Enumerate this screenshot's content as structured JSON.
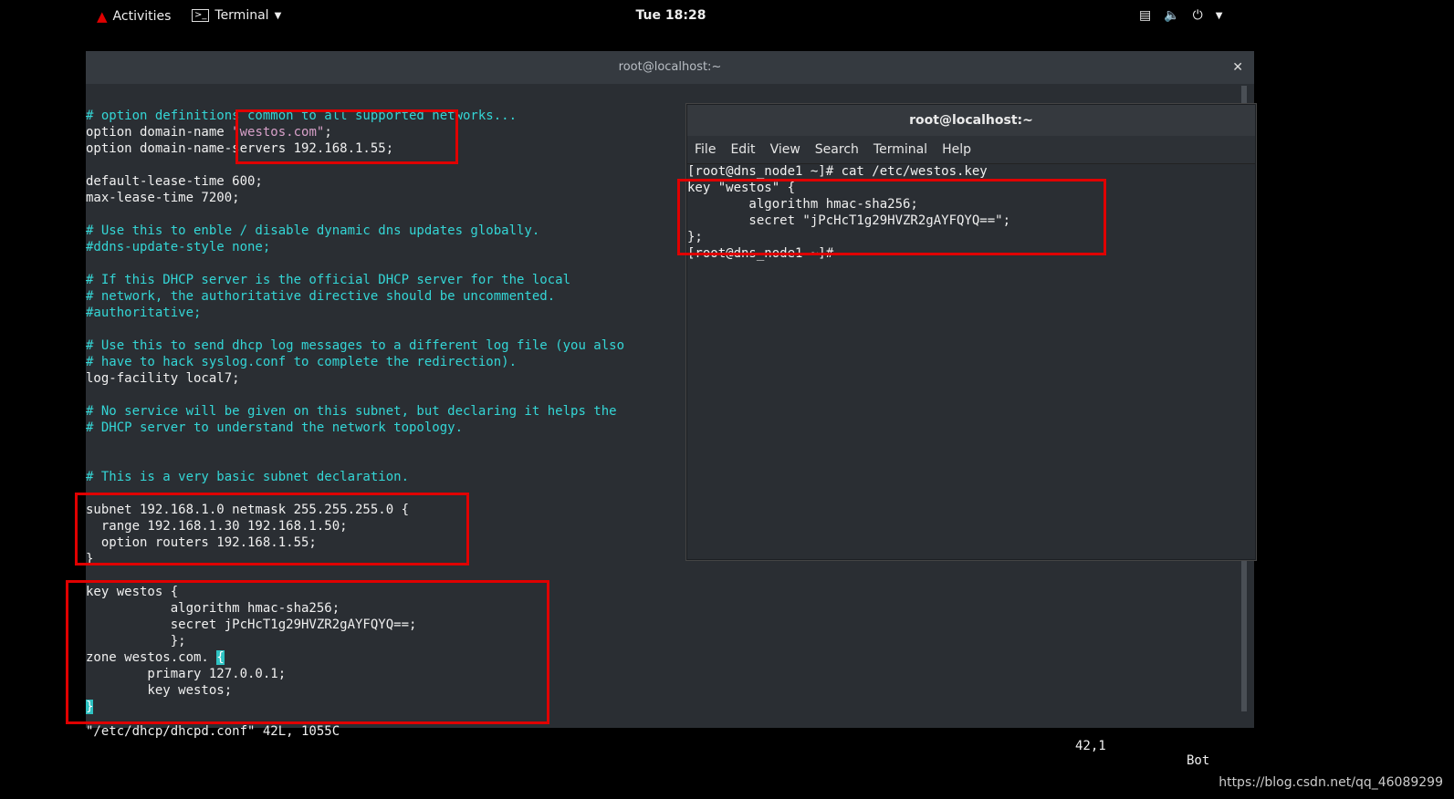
{
  "topbar": {
    "activities": "Activities",
    "app_menu": "Terminal",
    "clock": "Tue 18:28"
  },
  "main_window": {
    "title": "root@localhost:~",
    "lines": [
      {
        "text": "# option definitions common to all supported networks...",
        "style": "cyan"
      },
      {
        "segments": [
          {
            "text": "option domain-name ",
            "style": "white"
          },
          {
            "text": "\"westos.com\"",
            "style": "pink"
          },
          {
            "text": ";",
            "style": "white"
          }
        ]
      },
      {
        "text": "option domain-name-servers 192.168.1.55;",
        "style": "white"
      },
      {
        "text": "",
        "style": "white"
      },
      {
        "text": "default-lease-time 600;",
        "style": "white"
      },
      {
        "text": "max-lease-time 7200;",
        "style": "white"
      },
      {
        "text": "",
        "style": "white"
      },
      {
        "text": "# Use this to enble / disable dynamic dns updates globally.",
        "style": "cyan"
      },
      {
        "text": "#ddns-update-style none;",
        "style": "cyan"
      },
      {
        "text": "",
        "style": "white"
      },
      {
        "text": "# If this DHCP server is the official DHCP server for the local",
        "style": "cyan"
      },
      {
        "text": "# network, the authoritative directive should be uncommented.",
        "style": "cyan"
      },
      {
        "text": "#authoritative;",
        "style": "cyan"
      },
      {
        "text": "",
        "style": "white"
      },
      {
        "text": "# Use this to send dhcp log messages to a different log file (you also",
        "style": "cyan"
      },
      {
        "text": "# have to hack syslog.conf to complete the redirection).",
        "style": "cyan"
      },
      {
        "text": "log-facility local7;",
        "style": "white"
      },
      {
        "text": "",
        "style": "white"
      },
      {
        "text": "# No service will be given on this subnet, but declaring it helps the",
        "style": "cyan"
      },
      {
        "text": "# DHCP server to understand the network topology.",
        "style": "cyan"
      },
      {
        "text": "",
        "style": "white"
      },
      {
        "text": "",
        "style": "white"
      },
      {
        "text": "# This is a very basic subnet declaration.",
        "style": "cyan"
      },
      {
        "text": "",
        "style": "white"
      },
      {
        "text": "subnet 192.168.1.0 netmask 255.255.255.0 {",
        "style": "white"
      },
      {
        "text": "  range 192.168.1.30 192.168.1.50;",
        "style": "white"
      },
      {
        "text": "  option routers 192.168.1.55;",
        "style": "white"
      },
      {
        "text": "}",
        "style": "white"
      },
      {
        "text": "",
        "style": "white"
      },
      {
        "text": "key westos {",
        "style": "white"
      },
      {
        "text": "           algorithm hmac-sha256;",
        "style": "white"
      },
      {
        "text": "           secret jPcHcT1g29HVZR2gAYFQYQ==;",
        "style": "white"
      },
      {
        "text": "           };",
        "style": "white"
      },
      {
        "segments": [
          {
            "text": "zone westos.com. ",
            "style": "white"
          },
          {
            "text": "{",
            "style": "cursor"
          }
        ]
      },
      {
        "text": "        primary 127.0.0.1;",
        "style": "white"
      },
      {
        "text": "        key westos;",
        "style": "white"
      },
      {
        "segments": [
          {
            "text": "}",
            "style": "cursor"
          }
        ]
      }
    ],
    "status_left": "\"/etc/dhcp/dhcpd.conf\" 42L, 1055C",
    "status_pos": "42,1",
    "status_right": "Bot"
  },
  "second_window": {
    "title": "root@localhost:~",
    "menu": [
      "File",
      "Edit",
      "View",
      "Search",
      "Terminal",
      "Help"
    ],
    "lines": [
      "[root@dns_node1 ~]# cat /etc/westos.key",
      "key \"westos\" {",
      "        algorithm hmac-sha256;",
      "        secret \"jPcHcT1g29HVZR2gAYFQYQ==\";",
      "};",
      "[root@dns_node1 ~]#"
    ]
  },
  "watermark": "https://blog.csdn.net/qq_46089299"
}
